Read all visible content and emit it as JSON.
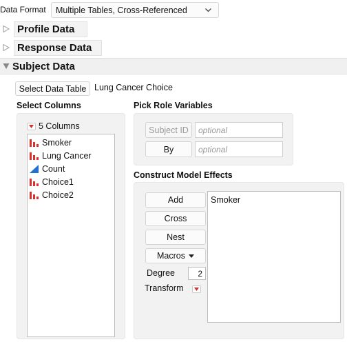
{
  "top": {
    "format_label": "Data Format",
    "format_value": "Multiple Tables, Cross-Referenced"
  },
  "sections": {
    "profile": "Profile Data",
    "response": "Response Data",
    "subject": "Subject Data"
  },
  "subject": {
    "select_table_button": "Select Data Table",
    "table_name": "Lung Cancer Choice"
  },
  "select_columns": {
    "title": "Select Columns",
    "count_label": "5 Columns",
    "columns": [
      {
        "name": "Smoker",
        "type": "nominal-icon"
      },
      {
        "name": "Lung Cancer",
        "type": "nominal-icon"
      },
      {
        "name": "Count",
        "type": "continuous-icon"
      },
      {
        "name": "Choice1",
        "type": "nominal-icon"
      },
      {
        "name": "Choice2",
        "type": "nominal-icon"
      }
    ]
  },
  "pick_role": {
    "title": "Pick Role Variables",
    "subject_id_button": "Subject ID",
    "subject_id_placeholder": "optional",
    "by_button": "By",
    "by_placeholder": "optional"
  },
  "model_effects": {
    "title": "Construct Model Effects",
    "add_button": "Add",
    "cross_button": "Cross",
    "nest_button": "Nest",
    "macros_button": "Macros",
    "degree_label": "Degree",
    "degree_value": "2",
    "transform_label": "Transform",
    "effects": [
      "Smoker"
    ]
  },
  "colors": {
    "nominal": "#d9302c",
    "continuous": "#1f6fd1",
    "red_arrow": "#d9302c"
  }
}
